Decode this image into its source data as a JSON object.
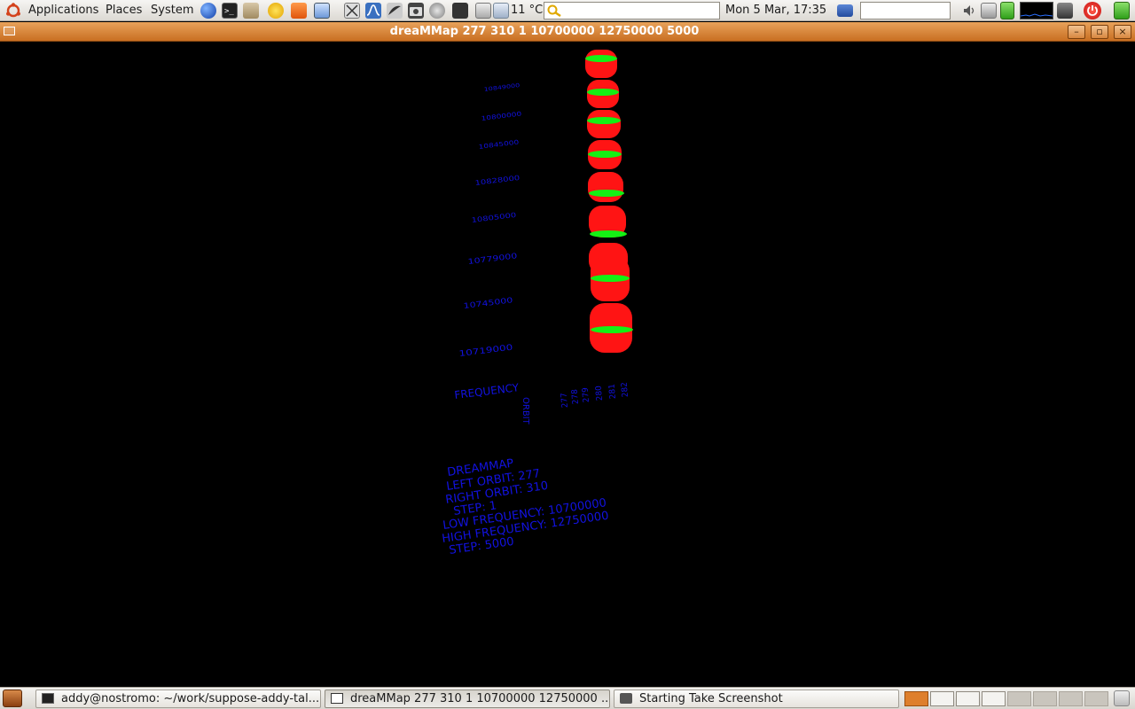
{
  "top_panel": {
    "menus": [
      "Applications",
      "Places",
      "System"
    ],
    "weather_temp": "11 °C",
    "clock": "Mon  5 Mar, 17:35"
  },
  "window": {
    "title": "dreaMMap 277 310 1 10700000 12750000 5000",
    "minimize": "–",
    "maximize": "▫",
    "close": "×"
  },
  "plot": {
    "freq_ticks": [
      "10849000",
      "10800000",
      "10845000",
      "10828000",
      "10805000",
      "10779000",
      "10745000",
      "10719000"
    ],
    "frequency_label": "FREQUENCY",
    "orbit_label": "ORBIT",
    "orbit_ticks": [
      "277",
      "278",
      "279",
      "280",
      "281",
      "282"
    ],
    "info_lines": [
      "DREAMMAP",
      "LEFT ORBIT: 277",
      "RIGHT ORBIT: 310",
      "STEP: 1",
      "LOW FREQUENCY: 10700000",
      "HIGH FREQUENCY: 12750000",
      "STEP: 5000"
    ],
    "colors": {
      "marker": "#ff1414",
      "band": "#14f014",
      "text": "#1212e0"
    }
  },
  "taskbar": {
    "tasks": [
      {
        "label": "addy@nostromo: ~/work/suppose-addy-tal..."
      },
      {
        "label": "dreaMMap 277 310 1 10700000 12750000 ..."
      },
      {
        "label": "Starting Take Screenshot"
      }
    ]
  }
}
